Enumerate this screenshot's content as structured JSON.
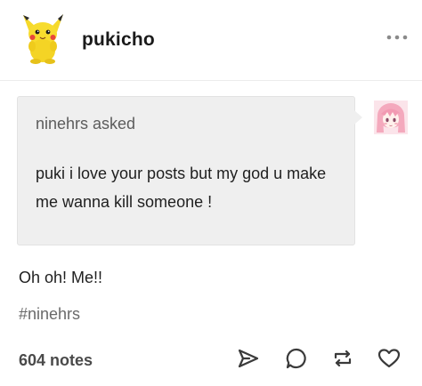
{
  "post": {
    "blog_name": "pukicho",
    "asker_line": "ninehrs asked",
    "question": "puki i love your posts but my god u make me wanna kill someone !",
    "answer": "Oh oh! Me!!",
    "tag": "#ninehrs",
    "notes": "604 notes"
  },
  "icons": {
    "avatar": "pikachu-plush-avatar",
    "asker_avatar": "pink-hair-anime-avatar",
    "more": "more-dots-icon",
    "share": "send-icon",
    "reply": "reply-bubble-icon",
    "reblog": "reblog-icon",
    "like": "heart-icon"
  },
  "colors": {
    "bubble_background": "#efefef",
    "avatar_yellow": "#f6d92a",
    "asker_pink": "#f4b8c8"
  }
}
